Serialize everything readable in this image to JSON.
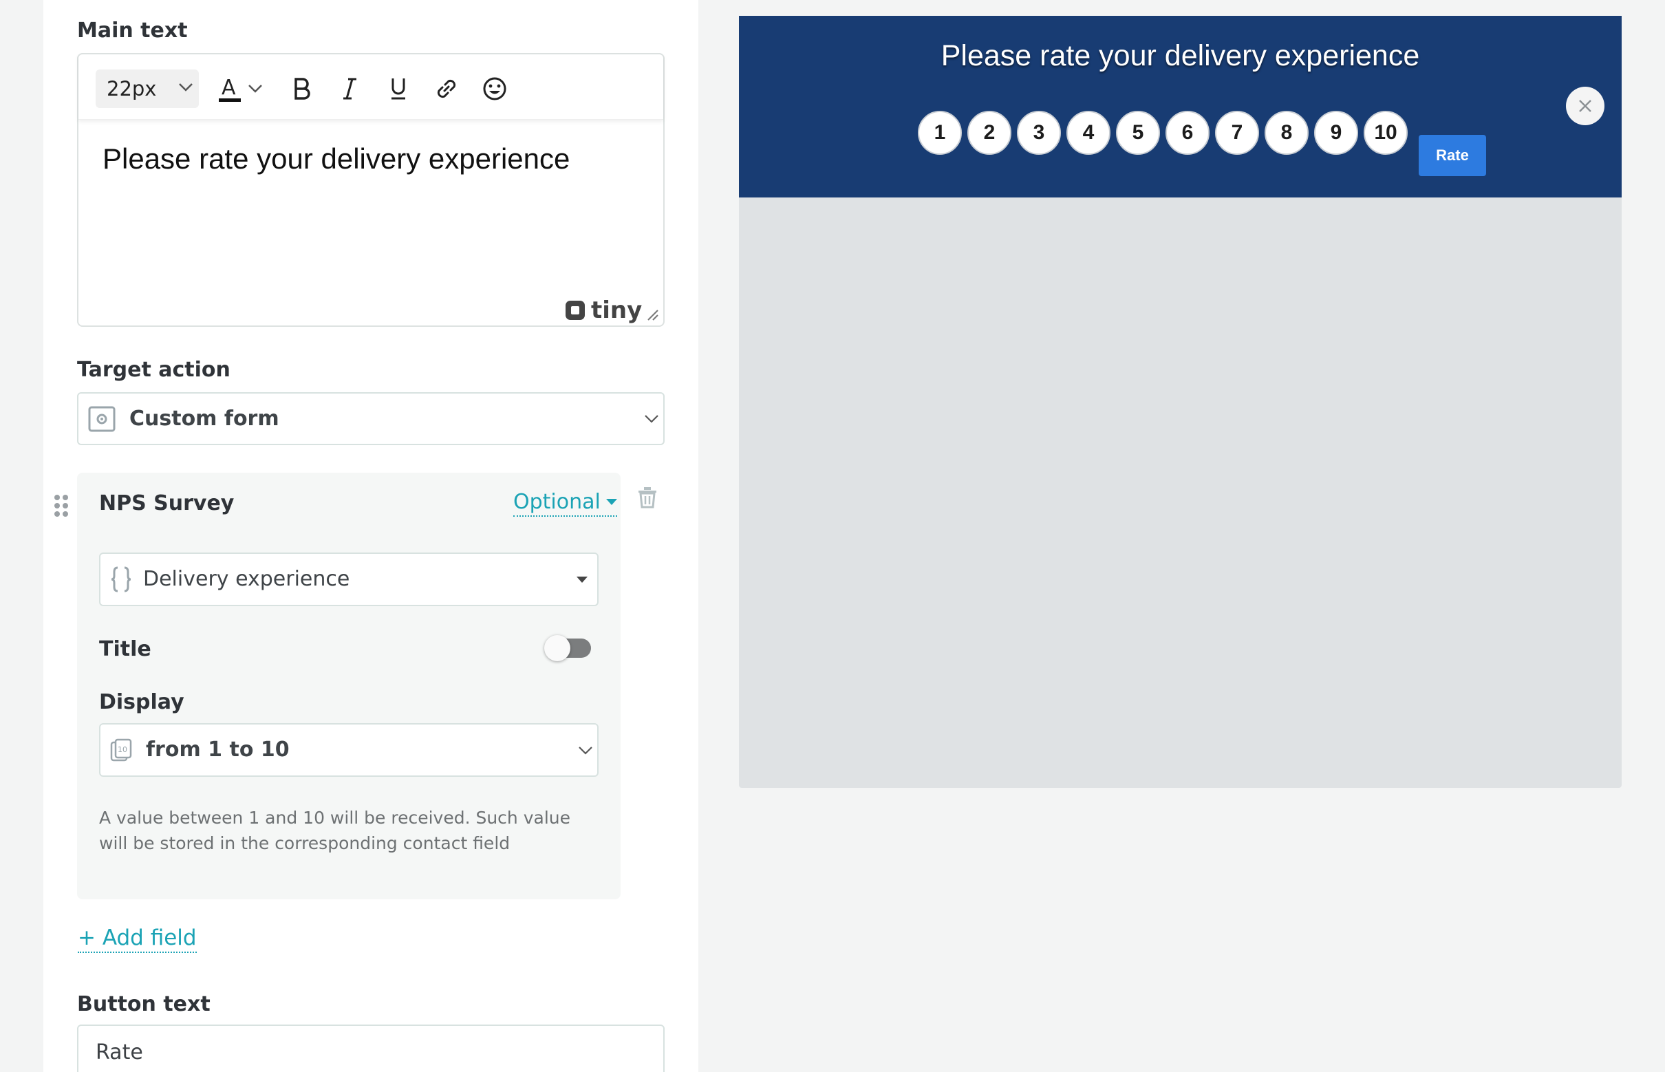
{
  "main_text": {
    "label": "Main text",
    "font_size": "22px",
    "content": "Please rate your delivery experience",
    "tiny_brand": "tiny"
  },
  "target_action": {
    "label": "Target action",
    "value": "Custom form"
  },
  "nps": {
    "title": "NPS Survey",
    "optional": "Optional",
    "field_value": "Delivery experience",
    "title_label": "Title",
    "title_toggle_on": false,
    "display_label": "Display",
    "display_value": "from 1 to 10",
    "help_text": "A value between 1 and 10 will be received. Such value will be stored in the corresponding contact field"
  },
  "add_field": "+ Add field",
  "button_text": {
    "label": "Button text",
    "value": "Rate"
  },
  "preview": {
    "title": "Please rate your delivery experience",
    "scores": [
      "1",
      "2",
      "3",
      "4",
      "5",
      "6",
      "7",
      "8",
      "9",
      "10"
    ],
    "button": "Rate"
  },
  "colors": {
    "accent": "#1ba3b5",
    "banner": "#183c73",
    "rate_button": "#2d7be0"
  }
}
